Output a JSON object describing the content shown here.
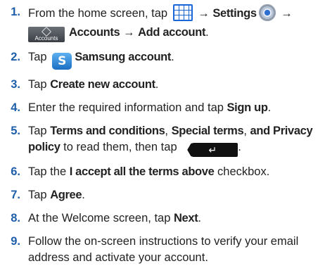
{
  "steps": [
    {
      "num": "1.",
      "line1": {
        "pre": "From the home screen, tap ",
        "arrow1": " → ",
        "settings": "Settings",
        "arrow2": " →"
      },
      "line2": {
        "accounts_icon_label": "Accounts",
        "accounts": "Accounts",
        "arrow": " → ",
        "add_account": "Add account",
        "end": "."
      }
    },
    {
      "num": "2.",
      "pre": "Tap ",
      "bold": "Samsung account",
      "end": "."
    },
    {
      "num": "3.",
      "pre": "Tap ",
      "bold": "Create new account",
      "end": "."
    },
    {
      "num": "4.",
      "pre": "Enter the required information and tap ",
      "bold": "Sign up",
      "end": "."
    },
    {
      "num": "5.",
      "pre": "Tap ",
      "bold1": "Terms and conditions",
      "mid1": ", ",
      "bold2": "Special terms",
      "mid2": ", ",
      "bold3": "and Privacy policy",
      "post": " to read them, then tap ",
      "end": "."
    },
    {
      "num": "6.",
      "pre": "Tap the ",
      "bold": "I accept all the terms above",
      "post": " checkbox."
    },
    {
      "num": "7.",
      "pre": "Tap ",
      "bold": "Agree",
      "end": "."
    },
    {
      "num": "8.",
      "pre": "At the Welcome screen, tap ",
      "bold": "Next",
      "end": "."
    },
    {
      "num": "9.",
      "text": "Follow the on-screen instructions to verify your email address and activate your account."
    }
  ],
  "icons": {
    "apps": "apps-grid-icon",
    "settings": "settings-gear-icon",
    "accounts": "accounts-icon",
    "samsung": "samsung-account-icon",
    "samsung_glyph": "S",
    "back": "back-key-icon",
    "back_glyph": "↵"
  },
  "colors": {
    "number": "#1f5ea8",
    "text": "#222222",
    "icon_blue": "#1a66d6"
  }
}
